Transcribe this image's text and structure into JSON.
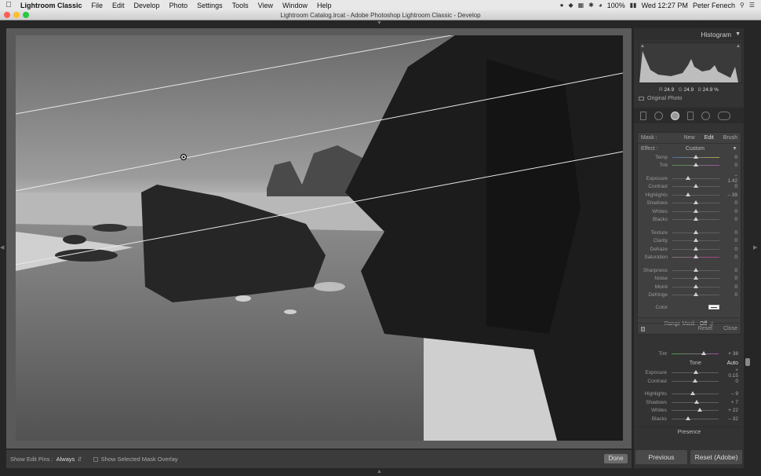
{
  "menubar": {
    "app_name": "Lightroom Classic",
    "items": [
      "File",
      "Edit",
      "Develop",
      "Photo",
      "Settings",
      "Tools",
      "View",
      "Window",
      "Help"
    ],
    "battery": "100%",
    "clock": "Wed 12:27 PM",
    "user": "Peter Fenech"
  },
  "window": {
    "title": "Lightroom Catalog.lrcat - Adobe Photoshop Lightroom Classic - Develop"
  },
  "toolbar": {
    "show_edit_pins_label": "Show Edit Pins :",
    "show_edit_pins_value": "Always",
    "mask_overlay_label": "Show Selected Mask Overlay",
    "done_label": "Done"
  },
  "histogram": {
    "title": "Histogram",
    "r_label": "R",
    "r_value": "24.9",
    "g_label": "G",
    "g_value": "24.9",
    "b_label": "B",
    "b_value": "24.9 %",
    "original_photo_label": "Original Photo"
  },
  "mask": {
    "label": "Mask :",
    "new": "New",
    "edit": "Edit",
    "brush": "Brush",
    "effect_label": "Effect :",
    "effect_value": "Custom",
    "sliders_group1": [
      {
        "label": "Temp",
        "value": "0",
        "pos": 0.5,
        "track": "temp"
      },
      {
        "label": "Tint",
        "value": "0",
        "pos": 0.5,
        "track": "tint"
      }
    ],
    "sliders_group2": [
      {
        "label": "Exposure",
        "value": "– 1.42",
        "pos": 0.34
      },
      {
        "label": "Contrast",
        "value": "0",
        "pos": 0.5
      },
      {
        "label": "Highlights",
        "value": "– 39",
        "pos": 0.34
      },
      {
        "label": "Shadows",
        "value": "0",
        "pos": 0.5
      },
      {
        "label": "Whites",
        "value": "0",
        "pos": 0.5
      },
      {
        "label": "Blacks",
        "value": "0",
        "pos": 0.5
      }
    ],
    "sliders_group3": [
      {
        "label": "Texture",
        "value": "0",
        "pos": 0.5
      },
      {
        "label": "Clarity",
        "value": "0",
        "pos": 0.5
      },
      {
        "label": "Dehaze",
        "value": "0",
        "pos": 0.5
      },
      {
        "label": "Saturation",
        "value": "0",
        "pos": 0.5,
        "track": "sat"
      }
    ],
    "sliders_group4": [
      {
        "label": "Sharpness",
        "value": "0",
        "pos": 0.5
      },
      {
        "label": "Noise",
        "value": "0",
        "pos": 0.5
      },
      {
        "label": "Moiré",
        "value": "0",
        "pos": 0.5
      },
      {
        "label": "Defringe",
        "value": "0",
        "pos": 0.5
      }
    ],
    "color_label": "Color",
    "range_mask_label": "Range Mask :",
    "range_mask_value": "Off",
    "reset": "Reset",
    "close": "Close"
  },
  "basic": {
    "tint_label": "Tint",
    "tint_value": "+ 38",
    "tone_label": "Tone",
    "auto_label": "Auto",
    "sliders_a": [
      {
        "label": "Exposure",
        "value": "+ 0.15",
        "pos": 0.52
      },
      {
        "label": "Contrast",
        "value": "0",
        "pos": 0.5
      }
    ],
    "sliders_b": [
      {
        "label": "Highlights",
        "value": "– 9",
        "pos": 0.45
      },
      {
        "label": "Shadows",
        "value": "+ 7",
        "pos": 0.54
      },
      {
        "label": "Whites",
        "value": "+ 22",
        "pos": 0.6
      },
      {
        "label": "Blacks",
        "value": "– 32",
        "pos": 0.35
      }
    ],
    "presence_label": "Presence"
  },
  "buttons": {
    "previous": "Previous",
    "reset_adobe": "Reset (Adobe)"
  }
}
